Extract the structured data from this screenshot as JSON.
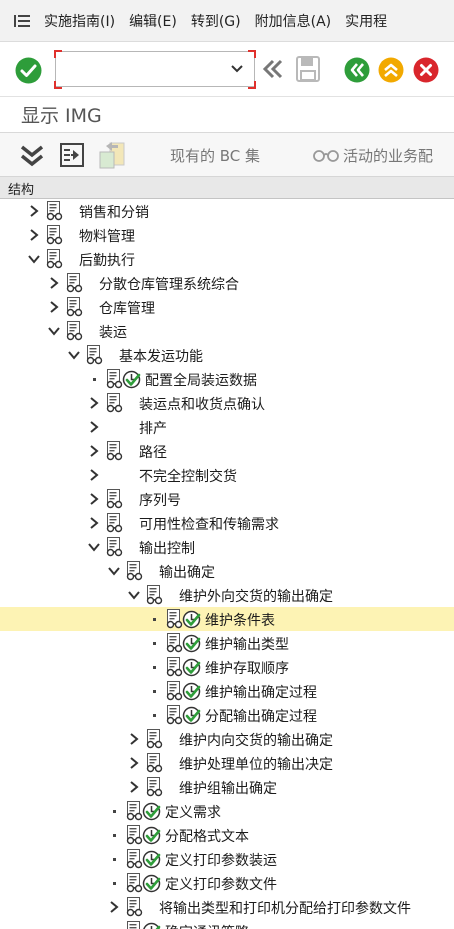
{
  "menu": {
    "items": [
      "实施指南(I)",
      "编辑(E)",
      "转到(G)",
      "附加信息(A)",
      "实用程"
    ]
  },
  "toolbar": {
    "command_value": ""
  },
  "title": "显示 IMG",
  "app_toolbar": {
    "bc_sets_label": "现有的 BC 集",
    "activity_label": "活动的业务配"
  },
  "structure_header": "结构",
  "colors": {
    "ok_green": "#2e9d3a",
    "exit_yellow": "#f2a900",
    "cancel_red": "#d9262c",
    "selected_row": "#fdf3b4",
    "command_focus": "#e0302c"
  },
  "tree": [
    {
      "level": 1,
      "toggle": "collapsed",
      "icon": "doc",
      "exec": false,
      "label": "销售和分销"
    },
    {
      "level": 1,
      "toggle": "collapsed",
      "icon": "doc",
      "exec": false,
      "label": "物料管理"
    },
    {
      "level": 1,
      "toggle": "expanded",
      "icon": "doc",
      "exec": false,
      "label": "后勤执行"
    },
    {
      "level": 2,
      "toggle": "collapsed",
      "icon": "doc",
      "exec": false,
      "label": "分散仓库管理系统综合"
    },
    {
      "level": 2,
      "toggle": "collapsed",
      "icon": "doc",
      "exec": false,
      "label": "仓库管理"
    },
    {
      "level": 2,
      "toggle": "expanded",
      "icon": "doc",
      "exec": false,
      "label": "装运"
    },
    {
      "level": 3,
      "toggle": "expanded",
      "icon": "doc",
      "exec": false,
      "label": "基本发运功能"
    },
    {
      "level": 4,
      "toggle": "leaf",
      "icon": "doc",
      "exec": true,
      "label": "配置全局装运数据"
    },
    {
      "level": 4,
      "toggle": "collapsed",
      "icon": "doc",
      "exec": false,
      "label": "装运点和收货点确认"
    },
    {
      "level": 4,
      "toggle": "collapsed",
      "icon": "none",
      "exec": false,
      "label": "排产"
    },
    {
      "level": 4,
      "toggle": "collapsed",
      "icon": "doc",
      "exec": false,
      "label": "路径"
    },
    {
      "level": 4,
      "toggle": "collapsed",
      "icon": "none",
      "exec": false,
      "label": "不完全控制交货"
    },
    {
      "level": 4,
      "toggle": "collapsed",
      "icon": "doc",
      "exec": false,
      "label": "序列号"
    },
    {
      "level": 4,
      "toggle": "collapsed",
      "icon": "doc",
      "exec": false,
      "label": "可用性检查和传输需求"
    },
    {
      "level": 4,
      "toggle": "expanded",
      "icon": "doc",
      "exec": false,
      "label": "输出控制"
    },
    {
      "level": 5,
      "toggle": "expanded",
      "icon": "doc",
      "exec": false,
      "label": "输出确定"
    },
    {
      "level": 6,
      "toggle": "expanded",
      "icon": "doc",
      "exec": false,
      "label": "维护外向交货的输出确定"
    },
    {
      "level": 7,
      "toggle": "leaf",
      "icon": "doc",
      "exec": true,
      "label": "维护条件表",
      "selected": true
    },
    {
      "level": 7,
      "toggle": "leaf",
      "icon": "doc",
      "exec": true,
      "label": "维护输出类型"
    },
    {
      "level": 7,
      "toggle": "leaf",
      "icon": "doc",
      "exec": true,
      "label": "维护存取顺序"
    },
    {
      "level": 7,
      "toggle": "leaf",
      "icon": "doc",
      "exec": true,
      "label": "维护输出确定过程"
    },
    {
      "level": 7,
      "toggle": "leaf",
      "icon": "doc",
      "exec": true,
      "label": "分配输出确定过程"
    },
    {
      "level": 6,
      "toggle": "collapsed",
      "icon": "doc",
      "exec": false,
      "label": "维护内向交货的输出确定"
    },
    {
      "level": 6,
      "toggle": "collapsed",
      "icon": "doc",
      "exec": false,
      "label": "维护处理单位的输出决定"
    },
    {
      "level": 6,
      "toggle": "collapsed",
      "icon": "doc",
      "exec": false,
      "label": "维护组输出确定"
    },
    {
      "level": 5,
      "toggle": "leaf",
      "icon": "doc",
      "exec": true,
      "label": "定义需求"
    },
    {
      "level": 5,
      "toggle": "leaf",
      "icon": "doc",
      "exec": true,
      "label": "分配格式文本"
    },
    {
      "level": 5,
      "toggle": "leaf",
      "icon": "doc",
      "exec": true,
      "label": "定义打印参数装运"
    },
    {
      "level": 5,
      "toggle": "leaf",
      "icon": "doc",
      "exec": true,
      "label": "定义打印参数文件"
    },
    {
      "level": 5,
      "toggle": "collapsed",
      "icon": "doc",
      "exec": false,
      "label": "将输出类型和打印机分配给打印参数文件"
    },
    {
      "level": 5,
      "toggle": "leaf",
      "icon": "doc",
      "exec": true,
      "label": "确定通讯策略"
    }
  ]
}
